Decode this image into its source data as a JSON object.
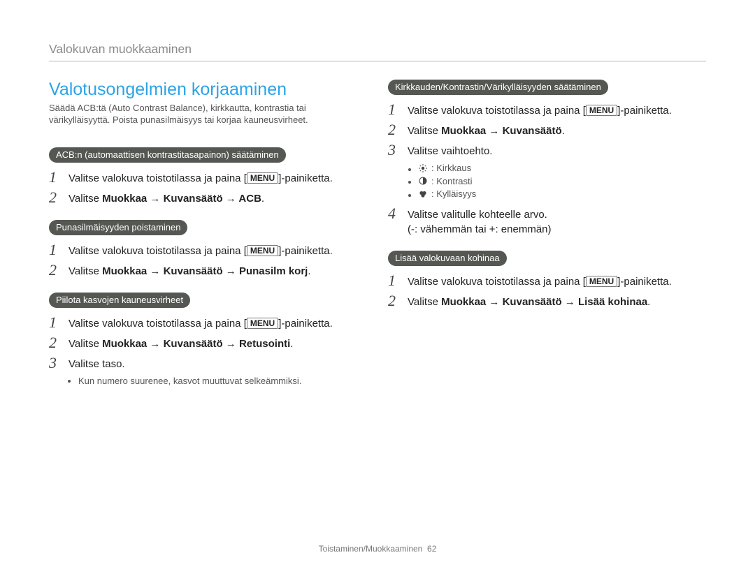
{
  "header": {
    "breadcrumb": "Valokuvan muokkaaminen"
  },
  "footer": {
    "section": "Toistaminen/Muokkaaminen",
    "page": "62"
  },
  "left": {
    "title": "Valotusongelmien korjaaminen",
    "intro": "Säädä ACB:tä (Auto Contrast Balance), kirkkautta, kontrastia tai värikylläisyyttä. Poista punasilmäisyys tai korjaa kauneusvirheet.",
    "block_acb": {
      "pill": "ACB:n (automaattisen kontrastitasapainon) säätäminen",
      "step1_a": "Valitse valokuva toistotilassa ja paina [",
      "menu": "MENU",
      "step1_b": "]-painiketta.",
      "step2_a": "Valitse ",
      "step2_b": "Muokkaa → Kuvansäätö → ACB",
      "step2_c": "."
    },
    "block_redeye": {
      "pill": "Punasilmäisyyden poistaminen",
      "step1_a": "Valitse valokuva toistotilassa ja paina [",
      "menu": "MENU",
      "step1_b": "]-painiketta.",
      "step2_a": "Valitse ",
      "step2_b": "Muokkaa → Kuvansäätö → Punasilm korj",
      "step2_c": "."
    },
    "block_retouch": {
      "pill": "Piilota kasvojen kauneusvirheet",
      "step1_a": "Valitse valokuva toistotilassa ja paina [",
      "menu": "MENU",
      "step1_b": "]-painiketta.",
      "step2_a": "Valitse ",
      "step2_b": "Muokkaa → Kuvansäätö → Retusointi",
      "step2_c": ".",
      "step3": "Valitse taso.",
      "bullet": "Kun numero suurenee, kasvot muuttuvat selkeämmiksi."
    }
  },
  "right": {
    "block_adjust": {
      "pill": "Kirkkauden/Kontrastin/Värikylläisyyden säätäminen",
      "step1_a": "Valitse valokuva toistotilassa ja paina [",
      "menu": "MENU",
      "step1_b": "]-painiketta.",
      "step2_a": "Valitse ",
      "step2_b": "Muokkaa → Kuvansäätö",
      "step2_c": ".",
      "step3": "Valitse vaihtoehto.",
      "opt_brightness": ": Kirkkaus",
      "opt_contrast": ": Kontrasti",
      "opt_saturation": ": Kylläisyys",
      "step4_a": "Valitse valitulle kohteelle arvo.",
      "step4_b": "(-: vähemmän tai +: enemmän)"
    },
    "block_noise": {
      "pill": "Lisää valokuvaan kohinaa",
      "step1_a": "Valitse valokuva toistotilassa ja paina [",
      "menu": "MENU",
      "step1_b": "]-painiketta.",
      "step2_a": "Valitse ",
      "step2_b": "Muokkaa → Kuvansäätö → Lisää kohinaa",
      "step2_c": "."
    }
  }
}
